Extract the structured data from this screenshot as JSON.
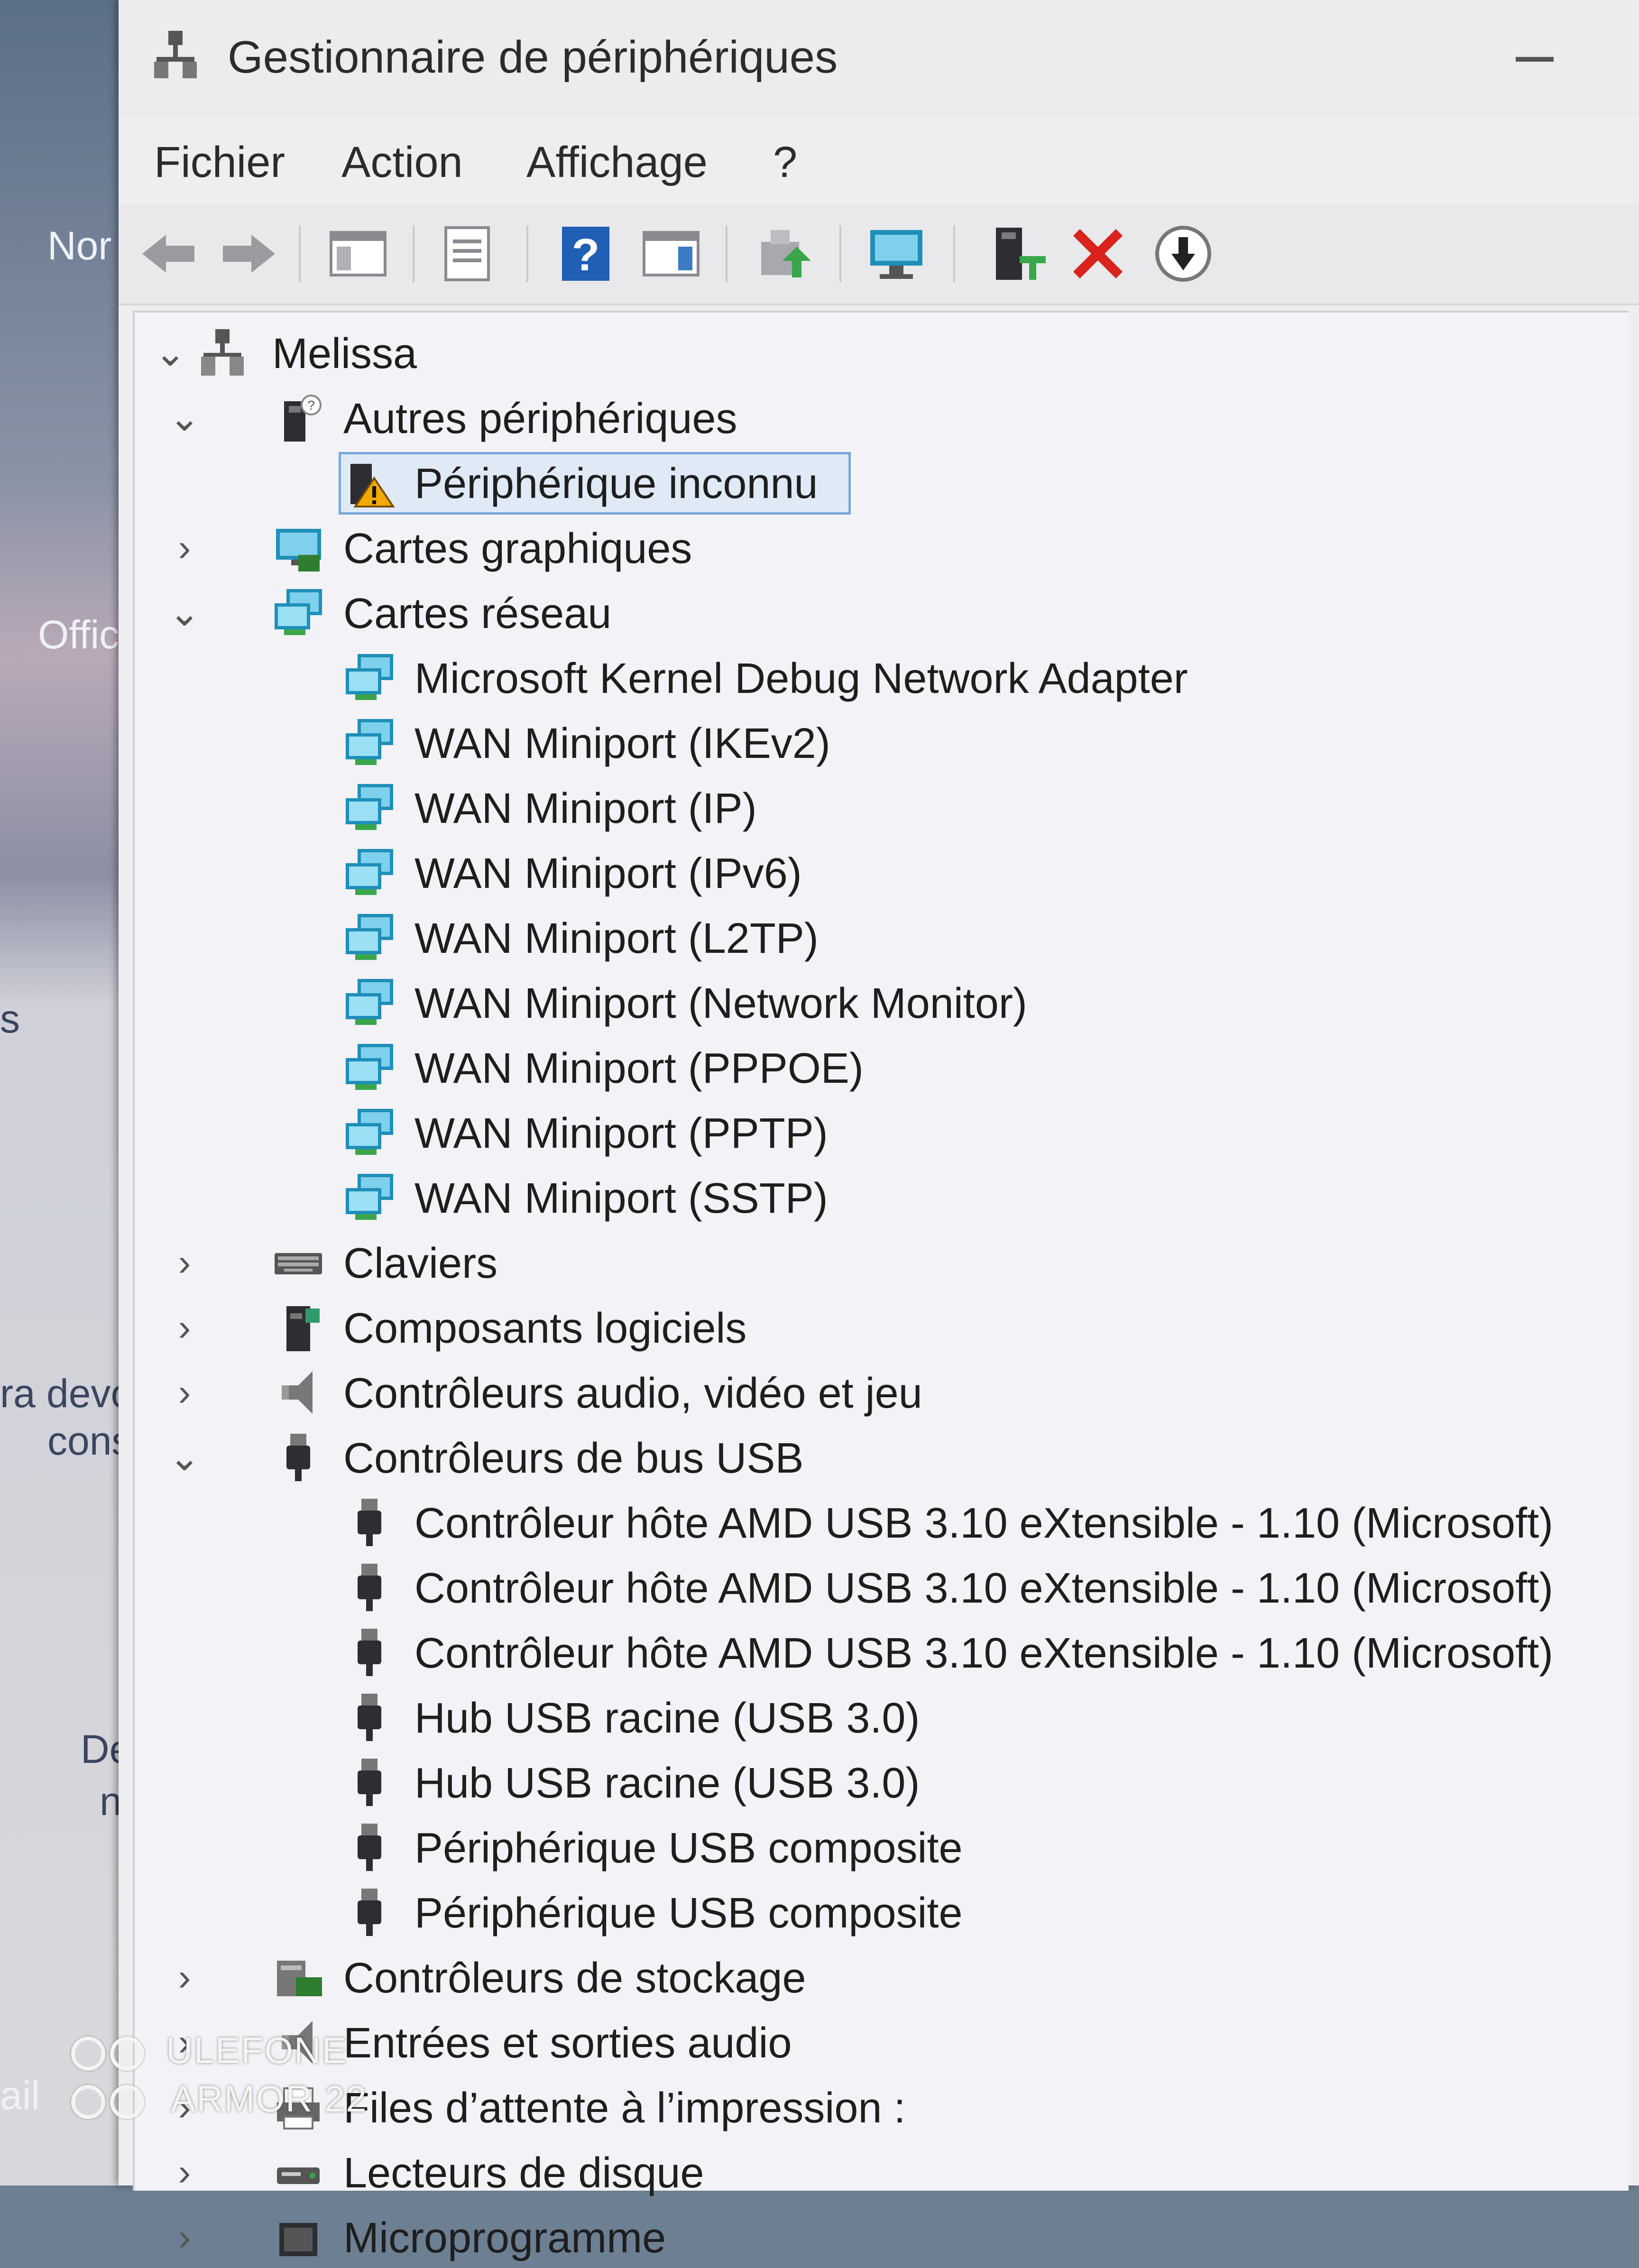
{
  "desktop": {
    "fragments": [
      "Nor",
      "Offic",
      "s",
      "ra  devo",
      "cons",
      "De",
      "na",
      "ail"
    ]
  },
  "window": {
    "title": "Gestionnaire de périphériques",
    "menu": [
      "Fichier",
      "Action",
      "Affichage",
      "?"
    ],
    "toolbar": [
      "back-icon",
      "forward-icon",
      "show-hide-console-tree-icon",
      "properties-icon",
      "help-icon",
      "action-pane-icon",
      "update-driver-icon",
      "scan-hardware-icon",
      "add-legacy-hardware-icon",
      "uninstall-device-icon",
      "download-driver-icon"
    ]
  },
  "tree": {
    "root": "Melissa",
    "nodes": [
      {
        "level": 1,
        "expanded": true,
        "label": "Autres périphériques",
        "icon": "other-devices-icon"
      },
      {
        "level": 2,
        "label": "Périphérique inconnu",
        "icon": "unknown-device-warning-icon",
        "selected": true
      },
      {
        "level": 1,
        "expanded": false,
        "label": "Cartes graphiques",
        "icon": "display-adapter-icon"
      },
      {
        "level": 1,
        "expanded": true,
        "label": "Cartes réseau",
        "icon": "network-adapter-icon"
      },
      {
        "level": 2,
        "label": "Microsoft Kernel Debug Network Adapter",
        "icon": "network-adapter-icon"
      },
      {
        "level": 2,
        "label": "WAN Miniport (IKEv2)",
        "icon": "network-adapter-icon"
      },
      {
        "level": 2,
        "label": "WAN Miniport (IP)",
        "icon": "network-adapter-icon"
      },
      {
        "level": 2,
        "label": "WAN Miniport (IPv6)",
        "icon": "network-adapter-icon"
      },
      {
        "level": 2,
        "label": "WAN Miniport (L2TP)",
        "icon": "network-adapter-icon"
      },
      {
        "level": 2,
        "label": "WAN Miniport (Network Monitor)",
        "icon": "network-adapter-icon"
      },
      {
        "level": 2,
        "label": "WAN Miniport (PPPOE)",
        "icon": "network-adapter-icon"
      },
      {
        "level": 2,
        "label": "WAN Miniport (PPTP)",
        "icon": "network-adapter-icon"
      },
      {
        "level": 2,
        "label": "WAN Miniport (SSTP)",
        "icon": "network-adapter-icon"
      },
      {
        "level": 1,
        "expanded": false,
        "label": "Claviers",
        "icon": "keyboard-icon"
      },
      {
        "level": 1,
        "expanded": false,
        "label": "Composants logiciels",
        "icon": "software-component-icon"
      },
      {
        "level": 1,
        "expanded": false,
        "label": "Contrôleurs audio, vidéo et jeu",
        "icon": "speaker-icon"
      },
      {
        "level": 1,
        "expanded": true,
        "label": "Contrôleurs de bus USB",
        "icon": "usb-icon"
      },
      {
        "level": 2,
        "label": "Contrôleur hôte AMD USB 3.10 eXtensible - 1.10 (Microsoft)",
        "icon": "usb-icon"
      },
      {
        "level": 2,
        "label": "Contrôleur hôte AMD USB 3.10 eXtensible - 1.10 (Microsoft)",
        "icon": "usb-icon"
      },
      {
        "level": 2,
        "label": "Contrôleur hôte AMD USB 3.10 eXtensible - 1.10 (Microsoft)",
        "icon": "usb-icon"
      },
      {
        "level": 2,
        "label": "Hub USB racine (USB 3.0)",
        "icon": "usb-icon"
      },
      {
        "level": 2,
        "label": "Hub USB racine (USB 3.0)",
        "icon": "usb-icon"
      },
      {
        "level": 2,
        "label": "Périphérique USB composite",
        "icon": "usb-icon"
      },
      {
        "level": 2,
        "label": "Périphérique USB composite",
        "icon": "usb-icon"
      },
      {
        "level": 1,
        "expanded": false,
        "label": "Contrôleurs de stockage",
        "icon": "storage-controller-icon"
      },
      {
        "level": 1,
        "expanded": false,
        "label": "Entrées et sorties audio",
        "icon": "speaker-icon"
      },
      {
        "level": 1,
        "expanded": false,
        "label": "Files d’attente à l’impression :",
        "icon": "printer-icon"
      },
      {
        "level": 1,
        "expanded": false,
        "label": "Lecteurs de disque",
        "icon": "disk-drive-icon"
      },
      {
        "level": 1,
        "expanded": false,
        "label": "Microprogramme",
        "icon": "firmware-icon"
      }
    ]
  },
  "watermark": {
    "line1": "ULEFONE",
    "line2": "ARMOR 22"
  },
  "colors": {
    "selection_border": "#7aa6d8",
    "uninstall_red": "#d9231c",
    "network_teal": "#1f8fb8",
    "help_blue": "#1f5fb5"
  }
}
